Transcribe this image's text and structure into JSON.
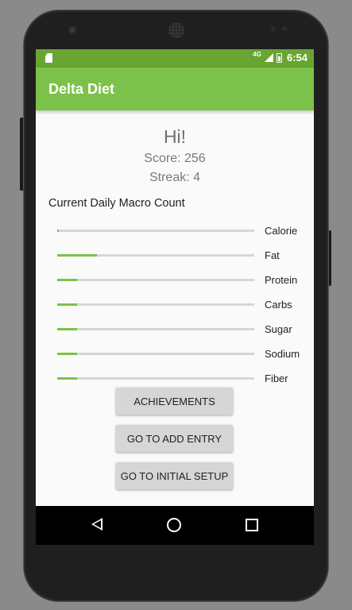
{
  "status_bar": {
    "network": "4G",
    "time": "6:54"
  },
  "app_bar": {
    "title": "Delta Diet"
  },
  "summary": {
    "greeting": "Hi!",
    "score": "Score: 256",
    "streak": "Streak: 4"
  },
  "macros": {
    "title": "Current Daily Macro Count",
    "items": [
      {
        "label": "Calorie",
        "progress": 0.01
      },
      {
        "label": "Fat",
        "progress": 0.2
      },
      {
        "label": "Protein",
        "progress": 0.1
      },
      {
        "label": "Carbs",
        "progress": 0.1
      },
      {
        "label": "Sugar",
        "progress": 0.1
      },
      {
        "label": "Sodium",
        "progress": 0.1
      },
      {
        "label": "Fiber",
        "progress": 0.1
      }
    ]
  },
  "buttons": {
    "achievements": "ACHIEVEMENTS",
    "add_entry": "GO TO ADD ENTRY",
    "initial_setup": "GO TO INITIAL SETUP"
  },
  "nav_bar": {
    "icons": [
      "back-icon",
      "home-icon",
      "recents-icon"
    ]
  },
  "colors": {
    "status_bar": "#68a532",
    "app_bar": "#7cc24a",
    "progress_fill": "#7cc24a",
    "progress_track": "#d6d6d6"
  }
}
